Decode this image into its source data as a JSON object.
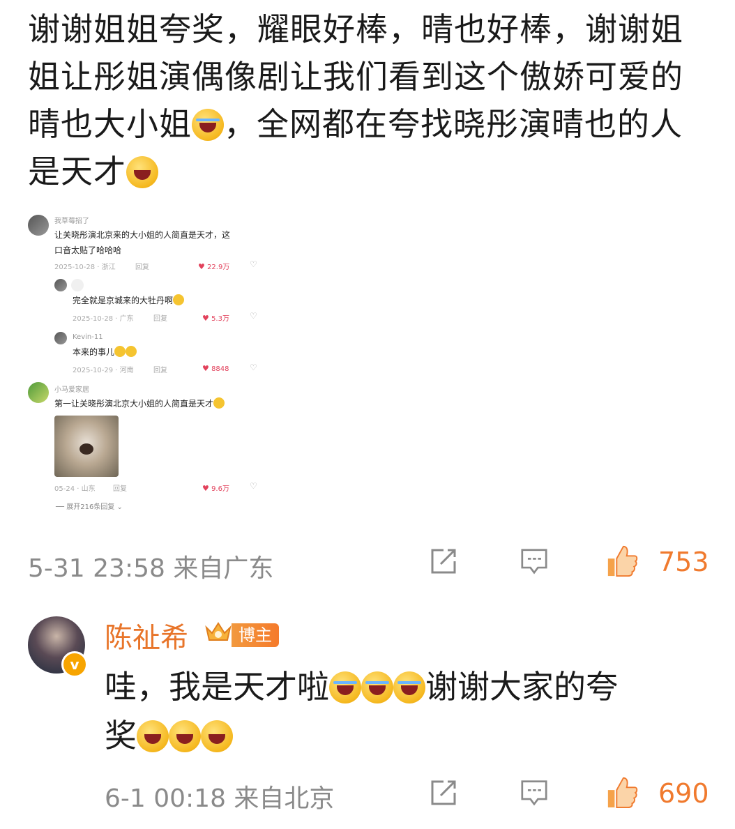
{
  "post": {
    "text_a": "谢谢姐姐夸奖，耀眼好棒，晴也好棒，谢谢姐姐让彤姐演偶像剧让我们看到这个傲娇可爱的晴也大小姐",
    "text_b": "，全网都在夸找晓彤演晴也的人是天才",
    "emoji_1": "laughing-tears-emoji",
    "emoji_2": "grinning-emoji"
  },
  "embedded": {
    "comments": [
      {
        "user": "我草莓招了",
        "text_line1": "让关晓彤演北京来的大小姐的人简直是天才，这",
        "text_line2": "口音太贴了哈哈哈",
        "date": "2025-10-28 · 浙江",
        "reply": "回复",
        "likes": "22.9万"
      },
      {
        "user": "",
        "text": "完全就是京城来的大牡丹啊",
        "date": "2025-10-28 · 广东",
        "reply": "回复",
        "likes": "5.3万"
      },
      {
        "user": "Kevin-11",
        "text": "本来的事儿",
        "date": "2025-10-29 · 河南",
        "reply": "回复",
        "likes": "8848"
      },
      {
        "user": "小马爱家居",
        "text": "第一让关晓彤演北京大小姐的人简直是天才",
        "date": "05-24 · 山东",
        "reply": "回复",
        "likes": "9.6万"
      }
    ],
    "expand": "展开216条回复"
  },
  "post_meta": {
    "time": "5-31 23:58 来自广东",
    "likes": "753"
  },
  "reply": {
    "name": "陈祉希",
    "badge": "博主",
    "text_a": "哇，我是天才啦",
    "text_b": "谢谢大家的夸",
    "text_c": "奖",
    "time": "6-1 00:18 来自北京",
    "likes": "690"
  },
  "icons": [
    "share-icon",
    "comment-icon",
    "like-icon",
    "heart-icon",
    "dislike-icon",
    "verified-icon",
    "crown-icon"
  ],
  "colors": {
    "accent": "#f07a2e",
    "username": "#e8752a",
    "like_red": "#e2415b",
    "meta_gray": "#8a8a8a"
  }
}
